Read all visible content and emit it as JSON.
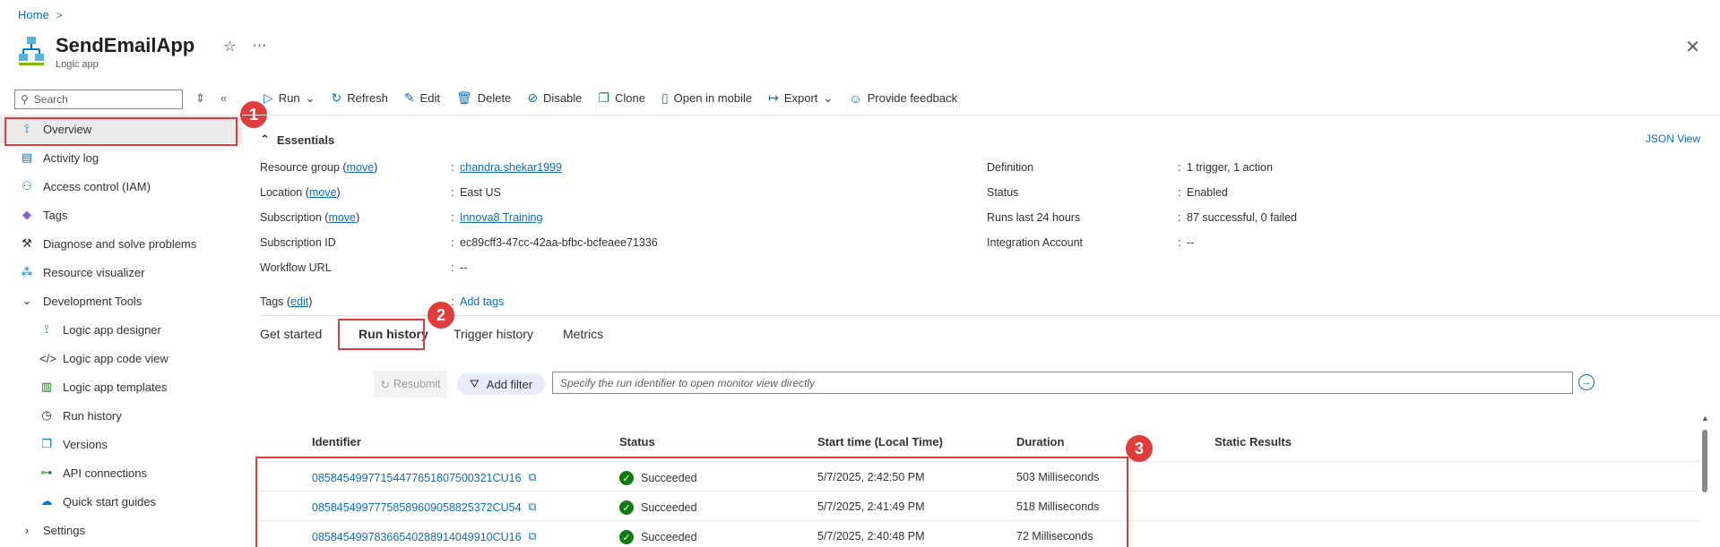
{
  "breadcrumb": {
    "home": "Home",
    "sep": ">"
  },
  "app": {
    "title": "SendEmailApp",
    "subtitle": "Logic app",
    "star": "☆",
    "more": "···",
    "close": "✕"
  },
  "search": {
    "placeholder": "Search"
  },
  "sidebar": {
    "items": [
      {
        "label": "Overview",
        "icon": "overview-icon"
      },
      {
        "label": "Activity log",
        "icon": "activity-log-icon"
      },
      {
        "label": "Access control (IAM)",
        "icon": "iam-icon"
      },
      {
        "label": "Tags",
        "icon": "tag-icon"
      },
      {
        "label": "Diagnose and solve problems",
        "icon": "wrench-icon"
      },
      {
        "label": "Resource visualizer",
        "icon": "visualizer-icon"
      },
      {
        "label": "Development Tools",
        "icon": "chevron-down-icon"
      },
      {
        "label": "Logic app designer",
        "icon": "designer-icon"
      },
      {
        "label": "Logic app code view",
        "icon": "code-icon"
      },
      {
        "label": "Logic app templates",
        "icon": "templates-icon"
      },
      {
        "label": "Run history",
        "icon": "history-icon"
      },
      {
        "label": "Versions",
        "icon": "versions-icon"
      },
      {
        "label": "API connections",
        "icon": "api-icon"
      },
      {
        "label": "Quick start guides",
        "icon": "quickstart-icon"
      },
      {
        "label": "Settings",
        "icon": "chevron-right-icon"
      }
    ]
  },
  "toolbar": {
    "run": "Run",
    "refresh": "Refresh",
    "edit": "Edit",
    "delete": "Delete",
    "disable": "Disable",
    "clone": "Clone",
    "open_mobile": "Open in mobile",
    "export": "Export",
    "feedback": "Provide feedback"
  },
  "essentials": {
    "heading": "Essentials",
    "json_view": "JSON View",
    "left": [
      {
        "label": "Resource group",
        "move": "move",
        "value": "chandra.shekar1999",
        "link": true
      },
      {
        "label": "Location",
        "move": "move",
        "value": "East US",
        "link": false
      },
      {
        "label": "Subscription",
        "move": "move",
        "value": "Innova8 Training",
        "link": true
      },
      {
        "label": "Subscription ID",
        "move": "",
        "value": "ec89cff3-47cc-42aa-bfbc-bcfeaee71336",
        "link": false
      },
      {
        "label": "Workflow URL",
        "move": "",
        "value": "--",
        "link": false
      }
    ],
    "right": [
      {
        "label": "Definition",
        "value": "1 trigger, 1 action"
      },
      {
        "label": "Status",
        "value": "Enabled"
      },
      {
        "label": "Runs last 24 hours",
        "value": "87 successful, 0 failed"
      },
      {
        "label": "Integration Account",
        "value": "--"
      }
    ],
    "tags": {
      "label": "Tags",
      "edit": "edit",
      "value": "Add tags"
    }
  },
  "tabs": [
    "Get started",
    "Run history",
    "Trigger history",
    "Metrics"
  ],
  "runs": {
    "resubmit": "Resubmit",
    "add_filter": "Add filter",
    "input_placeholder": "Specify the run identifier to open monitor view directly",
    "columns": [
      "Identifier",
      "Status",
      "Start time (Local Time)",
      "Duration",
      "Static Results"
    ],
    "rows": [
      {
        "id": "08584549977154477651807500321CU16",
        "status": "Succeeded",
        "start": "5/7/2025, 2:42:50 PM",
        "duration": "503 Milliseconds"
      },
      {
        "id": "08584549977758589609058825372CU54",
        "status": "Succeeded",
        "start": "5/7/2025, 2:41:49 PM",
        "duration": "518 Milliseconds"
      },
      {
        "id": "08584549978366540288914049910CU16",
        "status": "Succeeded",
        "start": "5/7/2025, 2:40:48 PM",
        "duration": "72 Milliseconds"
      }
    ]
  },
  "annotations": {
    "badge1": "1",
    "badge2": "2",
    "badge3": "3",
    "color": "#e03c3c"
  }
}
